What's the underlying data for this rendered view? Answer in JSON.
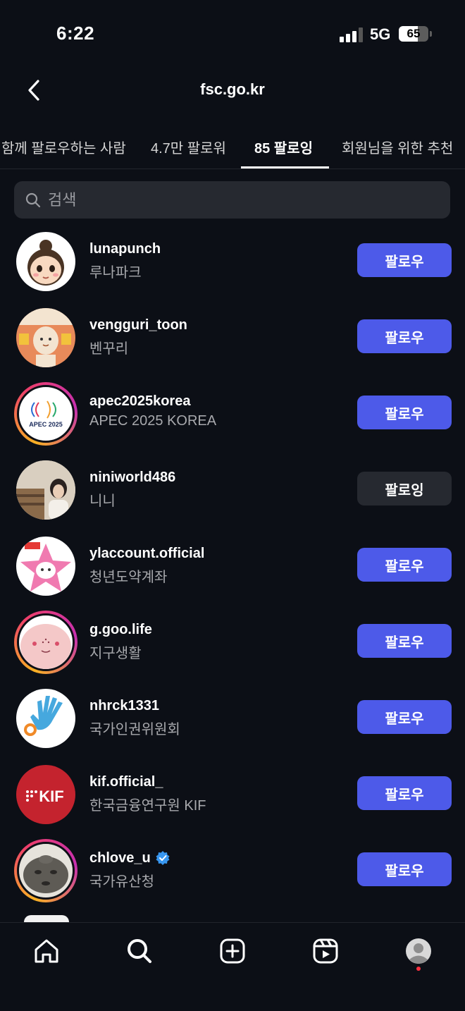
{
  "status": {
    "time": "6:22",
    "network": "5G",
    "battery": "65",
    "battery_level": 0.65
  },
  "header": {
    "title": "fsc.go.kr",
    "back_icon": "chevron-left-icon"
  },
  "tabs": [
    {
      "label": "함께 팔로우하는 사람",
      "active": false
    },
    {
      "label": "4.7만 팔로워",
      "active": false
    },
    {
      "label": "85 팔로잉",
      "active": true
    },
    {
      "label": "회원님을 위한 추천",
      "active": false
    }
  ],
  "search": {
    "placeholder": "검색",
    "value": ""
  },
  "accounts": [
    {
      "username": "lunapunch",
      "display_name": "루나파크",
      "button": "팔로우",
      "story_ring": false,
      "avatar_icon": "cartoon-girl-avatar"
    },
    {
      "username": "vengguri_toon",
      "display_name": "벤꾸리",
      "button": "팔로우",
      "story_ring": false,
      "avatar_icon": "cartoon-character-avatar"
    },
    {
      "username": "apec2025korea",
      "display_name": "APEC 2025 KOREA",
      "button": "팔로우",
      "story_ring": true,
      "avatar_icon": "apec-logo-avatar",
      "avatar_text": "APEC 2025"
    },
    {
      "username": "niniworld486",
      "display_name": "니니",
      "button": "팔로잉",
      "story_ring": false,
      "avatar_icon": "photo-avatar"
    },
    {
      "username": "ylaccount.official",
      "display_name": "청년도약계좌",
      "button": "팔로우",
      "story_ring": false,
      "avatar_icon": "star-mascot-avatar"
    },
    {
      "username": "g.goo.life",
      "display_name": "지구생활",
      "button": "팔로우",
      "story_ring": true,
      "avatar_icon": "pink-blob-avatar"
    },
    {
      "username": "nhrck1331",
      "display_name": "국가인권위원회",
      "button": "팔로우",
      "story_ring": false,
      "avatar_icon": "hand-logo-avatar"
    },
    {
      "username": "kif.official_",
      "display_name": "한국금융연구원 KIF",
      "button": "팔로우",
      "story_ring": false,
      "avatar_icon": "kif-logo-avatar",
      "avatar_text": "KIF"
    },
    {
      "username": "chlove_u",
      "display_name": "국가유산청",
      "button": "팔로우",
      "story_ring": true,
      "verified": true,
      "avatar_icon": "stone-face-avatar"
    }
  ],
  "colors": {
    "background": "#0c0f16",
    "follow_button": "#4d5ae9",
    "following_button": "#262930",
    "secondary_text": "#a8a9ad",
    "verified_badge": "#3897f0"
  },
  "tabbar": [
    "home-icon",
    "search-icon",
    "create-icon",
    "reels-icon",
    "profile-icon"
  ]
}
